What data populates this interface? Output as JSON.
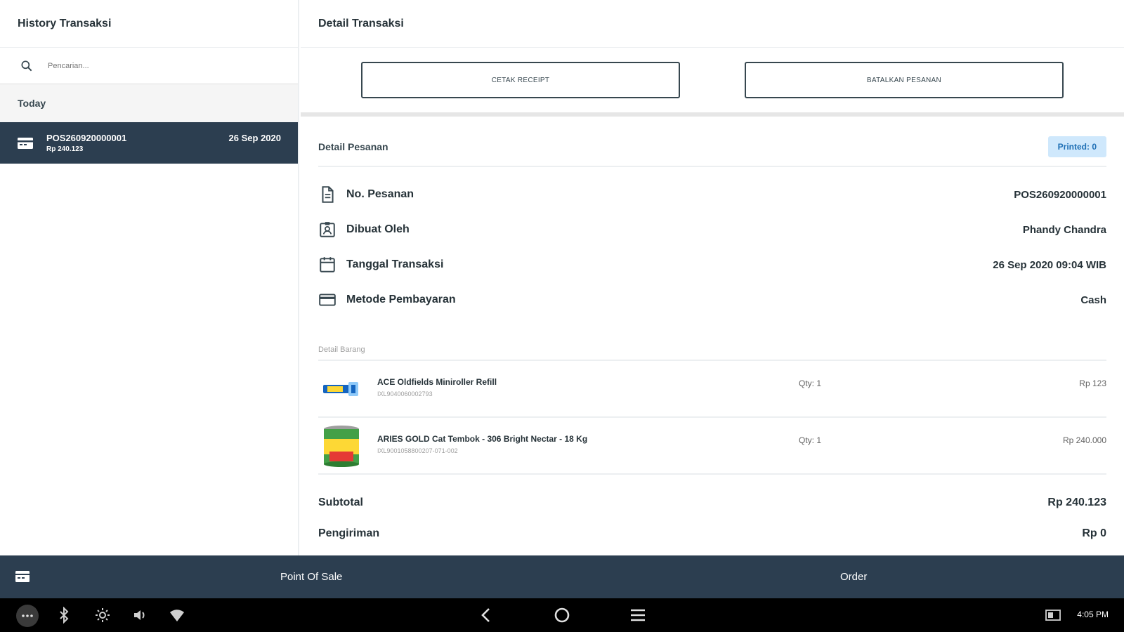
{
  "left": {
    "title": "History Transaksi",
    "search_placeholder": "Pencarian...",
    "group": "Today",
    "transactions": [
      {
        "id": "POS260920000001",
        "amount": "Rp 240.123",
        "date": "26 Sep 2020"
      }
    ]
  },
  "right": {
    "title": "Detail Transaksi",
    "btn_print": "CETAK RECEIPT",
    "btn_cancel": "BATALKAN PESANAN",
    "section_title": "Detail Pesanan",
    "badge": "Printed: 0",
    "info": [
      {
        "label": "No. Pesanan",
        "value": "POS260920000001"
      },
      {
        "label": "Dibuat Oleh",
        "value": "Phandy Chandra"
      },
      {
        "label": "Tanggal Transaksi",
        "value": "26 Sep 2020 09:04 WIB"
      },
      {
        "label": "Metode Pembayaran",
        "value": "Cash"
      }
    ],
    "items_title": "Detail Barang",
    "items": [
      {
        "name": "ACE Oldfields Miniroller Refill",
        "sku": "IXL9040060002793",
        "qty": "Qty: 1",
        "price": "Rp 123"
      },
      {
        "name": "ARIES GOLD Cat Tembok - 306 Bright Nectar - 18 Kg",
        "sku": "IXL9001058800207-071-002",
        "qty": "Qty: 1",
        "price": "Rp 240.000"
      }
    ],
    "subtotal_label": "Subtotal",
    "subtotal_value": "Rp 240.123",
    "shipping_label": "Pengiriman",
    "shipping_value": "Rp 0"
  },
  "appbar": {
    "tab_pos": "Point Of Sale",
    "tab_order": "Order"
  },
  "sysbar": {
    "time": "4:05 PM"
  },
  "colors": {
    "primary": "#2c3e50",
    "badge_bg": "#cfe8fc",
    "badge_text": "#1e6fb5"
  }
}
